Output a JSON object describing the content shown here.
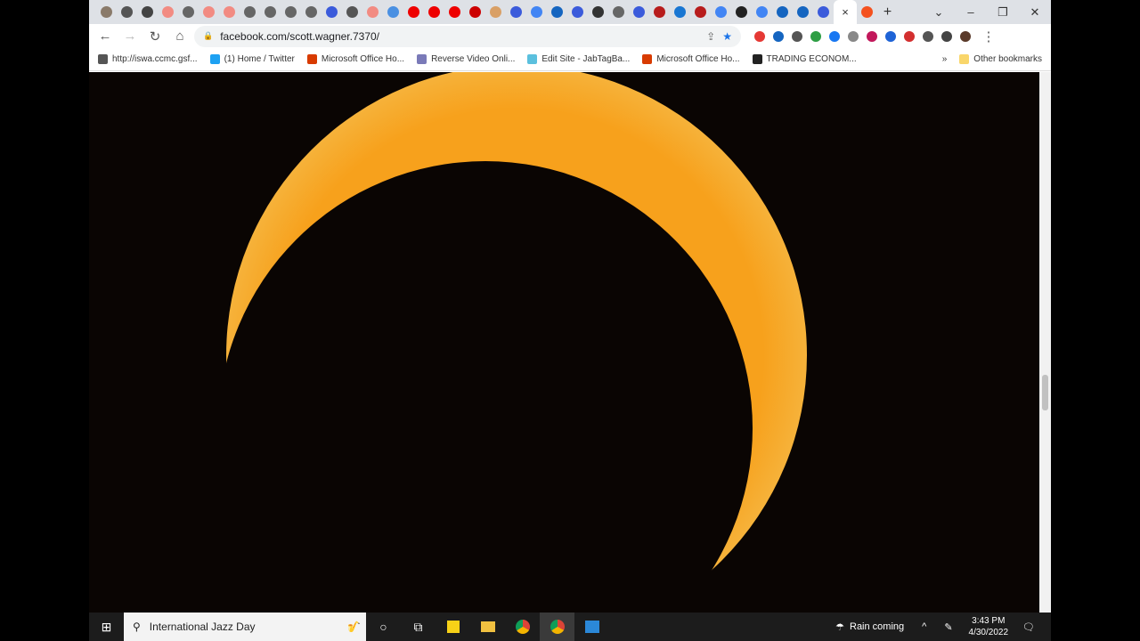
{
  "tabs": [
    {
      "c": "#8a7a6a"
    },
    {
      "c": "#555"
    },
    {
      "c": "#444"
    },
    {
      "c": "#f28b82"
    },
    {
      "c": "#666"
    },
    {
      "c": "#f28b82"
    },
    {
      "c": "#f28b82"
    },
    {
      "c": "#666"
    },
    {
      "c": "#666"
    },
    {
      "c": "#666"
    },
    {
      "c": "#666"
    },
    {
      "c": "#3b5bdb"
    },
    {
      "c": "#555"
    },
    {
      "c": "#f28b82"
    },
    {
      "c": "#4a90e2"
    },
    {
      "c": "#e00"
    },
    {
      "c": "#e00"
    },
    {
      "c": "#e00"
    },
    {
      "c": "#c00"
    },
    {
      "c": "#d9a066"
    },
    {
      "c": "#3b5bdb"
    },
    {
      "c": "#4285f4"
    },
    {
      "c": "#1565c0"
    },
    {
      "c": "#3b5bdb"
    },
    {
      "c": "#333"
    },
    {
      "c": "#666"
    },
    {
      "c": "#3b5bdb"
    },
    {
      "c": "#b71c1c"
    },
    {
      "c": "#1976d2"
    },
    {
      "c": "#b71c1c"
    },
    {
      "c": "#4285f4"
    },
    {
      "c": "#222"
    },
    {
      "c": "#4285f4"
    },
    {
      "c": "#1565c0"
    },
    {
      "c": "#1565c0"
    },
    {
      "c": "#3b5bdb"
    }
  ],
  "active_tab": {
    "close": "×"
  },
  "next_tab": {
    "c": "#f4511e"
  },
  "new_tab": "+",
  "window": {
    "tabsearch": "⌄",
    "minimize": "–",
    "restore": "❐",
    "close": "✕"
  },
  "toolbar": {
    "back": "←",
    "forward": "→",
    "reload": "↻",
    "home": "⌂",
    "url": "facebook.com/scott.wagner.7370/",
    "lock": "🔒",
    "share": "⇪",
    "star": "★",
    "menu": "⋮"
  },
  "extensions": [
    "#e53935",
    "#1565c0",
    "#555",
    "#2e9e44",
    "#1877f2",
    "#888",
    "#c2185b",
    "#1e63d6",
    "#d32f2f",
    "#555",
    "#444",
    "#5a3a2a"
  ],
  "bookmarks": [
    {
      "label": "http://iswa.ccmc.gsf...",
      "c": "#555"
    },
    {
      "label": "(1) Home / Twitter",
      "c": "#1da1f2"
    },
    {
      "label": "Microsoft Office Ho...",
      "c": "#d83b01"
    },
    {
      "label": "Reverse Video Onli...",
      "c": "#7a7ab8"
    },
    {
      "label": "Edit Site - JabTagBa...",
      "c": "#5bc0de"
    },
    {
      "label": "Microsoft Office Ho...",
      "c": "#d83b01"
    },
    {
      "label": "TRADING ECONOM...",
      "c": "#222"
    }
  ],
  "bookmarks_more": "»",
  "other_bookmarks": "Other bookmarks",
  "colors": {
    "sun": "#f7a11c",
    "sun_edge": "#f9c04a",
    "sky": "#0a0503"
  },
  "taskbar": {
    "search_text": "International Jazz Day",
    "weather": "Rain coming",
    "time": "3:43 PM",
    "date": "4/30/2022"
  }
}
